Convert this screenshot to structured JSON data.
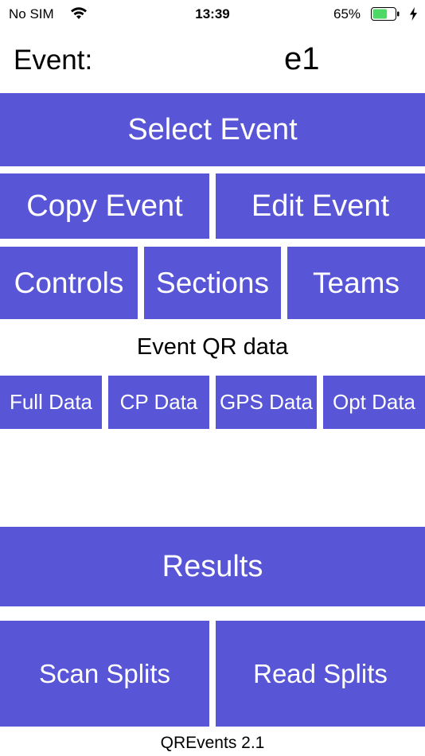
{
  "status_bar": {
    "carrier": "No SIM",
    "time": "13:39",
    "battery_percent": "65%",
    "battery_level": 0.65,
    "icons": [
      "wifi-icon",
      "battery-icon",
      "charging-bolt-icon"
    ]
  },
  "event": {
    "label": "Event:",
    "name": "e1"
  },
  "buttons": {
    "select_event": "Select Event",
    "copy_event": "Copy Event",
    "edit_event": "Edit Event",
    "controls": "Controls",
    "sections": "Sections",
    "teams": "Teams"
  },
  "qr": {
    "caption": "Event QR data",
    "full_data": "Full Data",
    "cp_data": "CP Data",
    "gps_data": "GPS Data",
    "opt_data": "Opt Data"
  },
  "bottom": {
    "results": "Results",
    "scan_splits": "Scan Splits",
    "read_splits": "Read Splits"
  },
  "footer": {
    "version": "QREvents 2.1"
  },
  "colors": {
    "button_bg": "#5856d6",
    "button_text": "#ffffff",
    "battery_fill": "#4cd964"
  }
}
